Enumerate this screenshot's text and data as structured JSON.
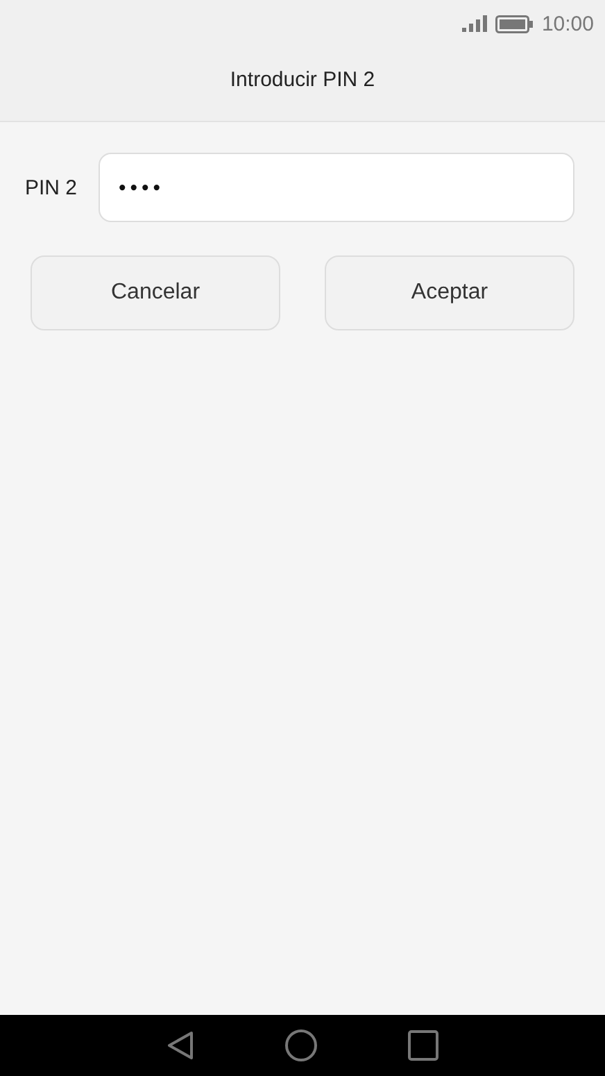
{
  "status_bar": {
    "time": "10:00"
  },
  "title": "Introducir PIN 2",
  "pin_field": {
    "label": "PIN 2",
    "value": "••••"
  },
  "buttons": [
    "Cancelar",
    "Aceptar"
  ]
}
